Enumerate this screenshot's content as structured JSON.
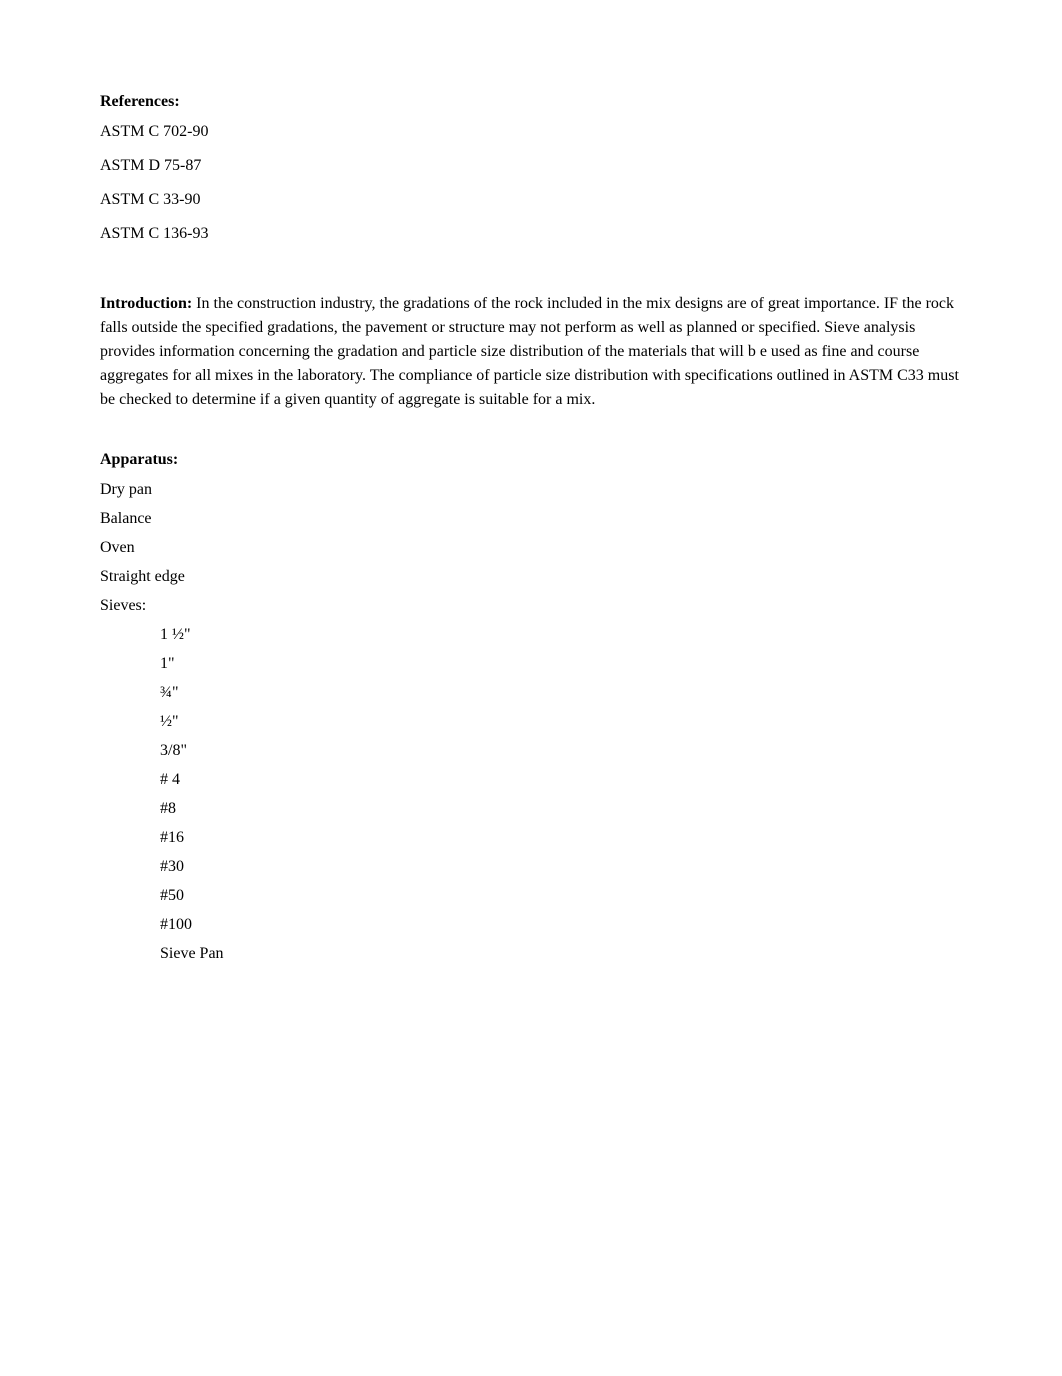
{
  "references": {
    "heading": "References:",
    "items": [
      "ASTM C 702-90",
      "ASTM D 75-87",
      "ASTM C 33-90",
      "ASTM C 136-93"
    ]
  },
  "introduction": {
    "heading": "Introduction:",
    "body": " In the construction industry, the gradations of the rock included in the mix designs are of great importance. IF the rock falls outside the specified gradations, the pavement or structure may not perform as well as planned or specified. Sieve analysis provides information concerning the gradation and particle size distribution of the materials that will b e used as fine and course aggregates for all mixes in the laboratory. The compliance of particle size distribution with specifications outlined in ASTM C33 must be checked to determine if a given quantity of aggregate is suitable for a mix."
  },
  "apparatus": {
    "heading": "Apparatus:",
    "items": [
      "Dry pan",
      "Balance",
      "Oven",
      "Straight edge"
    ],
    "sieves_label": "Sieves:",
    "sieves": [
      "1 ½\"",
      "1\"",
      "¾\"",
      "½\"",
      "3/8\"",
      "# 4",
      "#8",
      "#16",
      "#30",
      "#50",
      "#100",
      "Sieve Pan"
    ]
  }
}
